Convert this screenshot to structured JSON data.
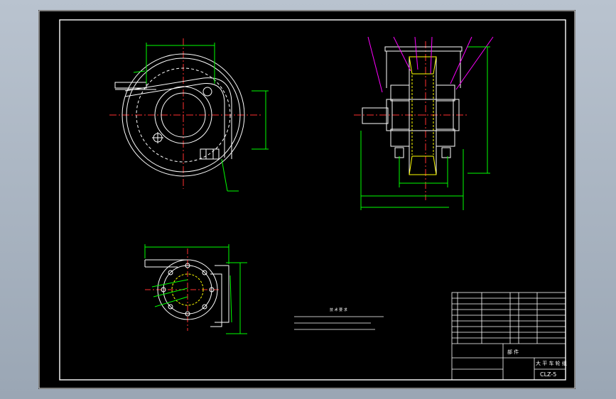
{
  "title_block": {
    "part_word": "部 件",
    "name": "大 平 车 轮 组",
    "drawing_number": "CLZ-5"
  },
  "technical_requirements": {
    "heading": "技 术 要 求"
  },
  "colors": {
    "background": "#000000",
    "line": "#ffffff",
    "dimension": "#00ff00",
    "centerline": "#ff3030",
    "hidden": "#ffff00",
    "leader": "#ff00ff",
    "screen": "#a9b4c2"
  }
}
